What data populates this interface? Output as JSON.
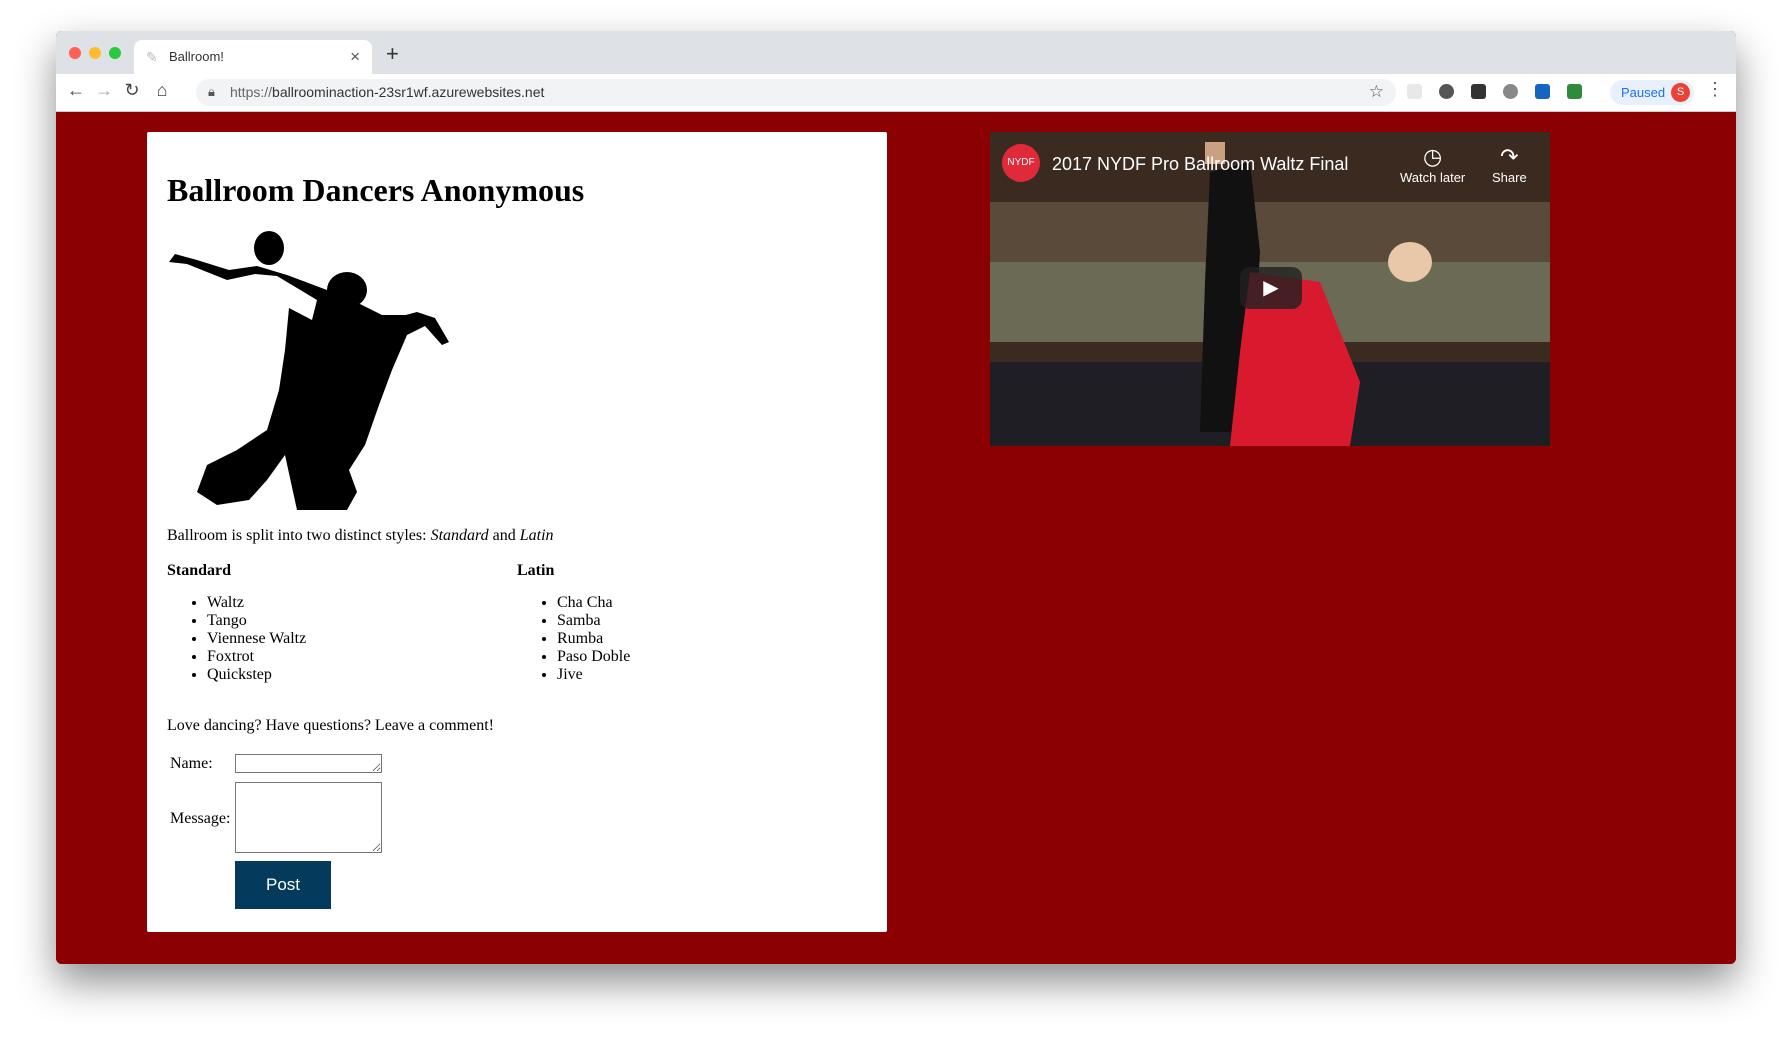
{
  "browser": {
    "tab_title": "Ballroom!",
    "url_prefix": "https://",
    "url_host": "ballroominaction-23sr1wf.azurewebsites.net",
    "paused_label": "Paused",
    "avatar_initial": "S"
  },
  "page": {
    "heading": "Ballroom Dancers Anonymous",
    "intro_text": "Ballroom is split into two distinct styles: ",
    "intro_standard": "Standard",
    "intro_and": " and ",
    "intro_latin": "Latin",
    "standard": {
      "title": "Standard",
      "items": [
        "Waltz",
        "Tango",
        "Viennese Waltz",
        "Foxtrot",
        "Quickstep"
      ]
    },
    "latin": {
      "title": "Latin",
      "items": [
        "Cha Cha",
        "Samba",
        "Rumba",
        "Paso Doble",
        "Jive"
      ]
    },
    "comment_prompt": "Love dancing? Have questions? Leave a comment!",
    "form": {
      "name_label": "Name:",
      "name_value": "",
      "message_label": "Message:",
      "message_value": "",
      "post_label": "Post"
    }
  },
  "video": {
    "channel_logo_text": "NYDF",
    "title": "2017 NYDF Pro Ballroom Waltz Final",
    "watch_later_label": "Watch later",
    "share_label": "Share"
  },
  "colors": {
    "page_background": "#8b0000",
    "post_button": "#043a5c",
    "paused_text": "#1a73e8"
  }
}
